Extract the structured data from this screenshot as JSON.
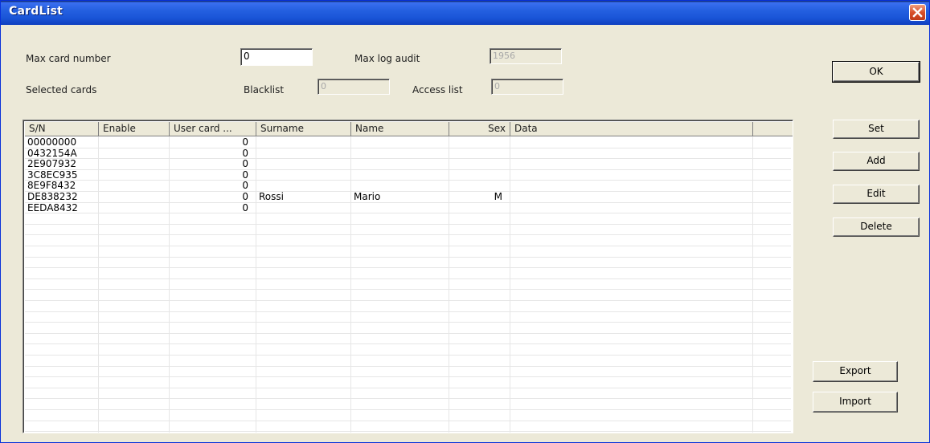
{
  "window": {
    "title": "CardList"
  },
  "fields": {
    "max_card_number": {
      "label": "Max card number",
      "value": "0"
    },
    "max_log_audit": {
      "label": "Max log audit",
      "value": "1956"
    },
    "selected_cards": {
      "label": "Selected cards"
    },
    "blacklist": {
      "label": "Blacklist",
      "value": "0"
    },
    "access_list": {
      "label": "Access list",
      "value": "0"
    }
  },
  "buttons": {
    "ok": "OK",
    "set": "Set",
    "add": "Add",
    "edit": "Edit",
    "delete": "Delete",
    "export": "Export",
    "import": "Import"
  },
  "table": {
    "columns": [
      "S/N",
      "Enable",
      "User card ...",
      "Surname",
      "Name",
      "Sex",
      "Data"
    ],
    "rows": [
      {
        "sn": "00000000",
        "enable": "",
        "user_card": "0",
        "surname": "",
        "name": "",
        "sex": "",
        "data": ""
      },
      {
        "sn": "0432154A",
        "enable": "",
        "user_card": "0",
        "surname": "",
        "name": "",
        "sex": "",
        "data": ""
      },
      {
        "sn": "2E907932",
        "enable": "",
        "user_card": "0",
        "surname": "",
        "name": "",
        "sex": "",
        "data": ""
      },
      {
        "sn": "3C8EC935",
        "enable": "",
        "user_card": "0",
        "surname": "",
        "name": "",
        "sex": "",
        "data": ""
      },
      {
        "sn": "8E9F8432",
        "enable": "",
        "user_card": "0",
        "surname": "",
        "name": "",
        "sex": "",
        "data": ""
      },
      {
        "sn": "DE838232",
        "enable": "",
        "user_card": "0",
        "surname": "Rossi",
        "name": "Mario",
        "sex": "M",
        "data": ""
      },
      {
        "sn": "EEDA8432",
        "enable": "",
        "user_card": "0",
        "surname": "",
        "name": "",
        "sex": "",
        "data": ""
      }
    ]
  },
  "colors": {
    "titlebar": "#2460e0",
    "window_bg": "#ece9d8",
    "close_button": "#d8502a"
  },
  "icons": {
    "close": "close-icon"
  }
}
